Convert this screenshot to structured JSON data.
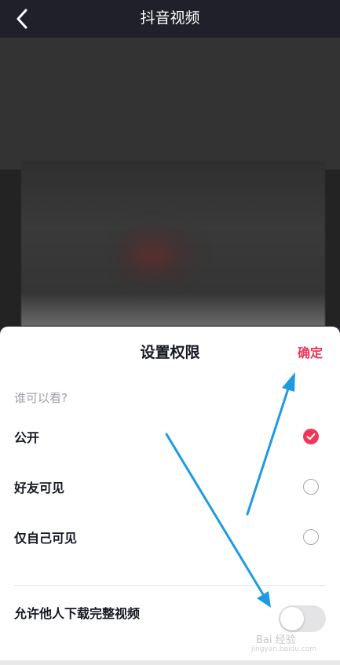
{
  "nav": {
    "title": "抖音视频",
    "back_icon": "chevron-left-icon"
  },
  "sheet": {
    "title": "设置权限",
    "confirm_label": "确定",
    "section_label": "谁可以看?",
    "options": [
      {
        "label": "公开",
        "selected": true
      },
      {
        "label": "好友可见",
        "selected": false
      },
      {
        "label": "仅自己可见",
        "selected": false
      }
    ],
    "download_label": "允许他人下载完整视频",
    "download_enabled": false
  },
  "watermark": {
    "text": "Bai 经验",
    "sub": "jingyan.baidu.com"
  },
  "colors": {
    "accent": "#f2365a",
    "annotation_arrow": "#1e9be0",
    "nav_bg": "#1f2029"
  }
}
